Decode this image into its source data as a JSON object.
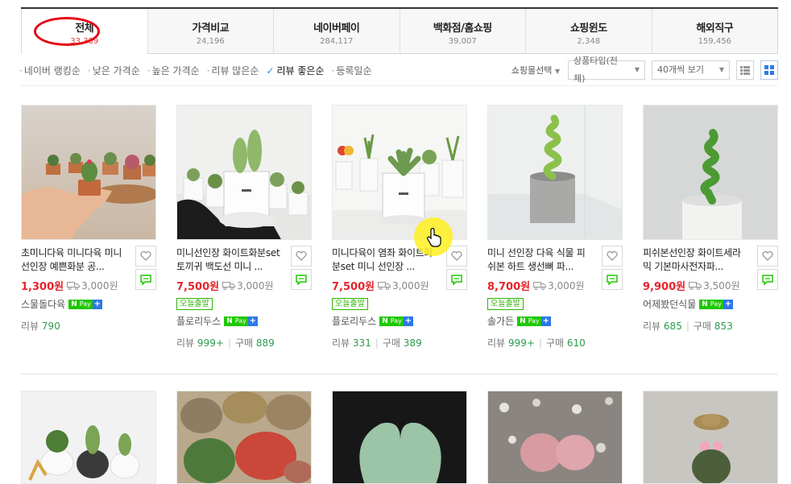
{
  "tabs": [
    {
      "name": "전체",
      "count": "33,389",
      "active": true
    },
    {
      "name": "가격비교",
      "count": "24,196"
    },
    {
      "name": "네이버페이",
      "count": "284,117"
    },
    {
      "name": "백화점/홈쇼핑",
      "count": "39,007"
    },
    {
      "name": "쇼핑윈도",
      "count": "2,348"
    },
    {
      "name": "해외직구",
      "count": "159,456"
    }
  ],
  "sort": {
    "options": [
      "네이버 랭킹순",
      "낮은 가격순",
      "높은 가격순",
      "리뷰 많은순",
      "리뷰 좋은순",
      "등록일순"
    ],
    "active": "리뷰 좋은순"
  },
  "filters": {
    "mall_label": "쇼핑몰선택",
    "type_select": "상품타입(전체)",
    "count_select": "40개씩 보기"
  },
  "products": [
    {
      "title": "초미니다육 미니다육 미니선인장 예쁜화분 공...",
      "price": "1,300원",
      "shipping": "3,000원",
      "seller": "스물돌다육",
      "today": "",
      "review_label": "리뷰",
      "review_count": "790",
      "buy_label": "",
      "buy_count": ""
    },
    {
      "title": "미니선인장 화이트화분set 토끼귀 백도선 미니 ...",
      "price": "7,500원",
      "shipping": "3,000원",
      "seller": "플로리두스",
      "today": "오늘출발",
      "review_label": "리뷰",
      "review_count": "999+",
      "buy_label": "구매",
      "buy_count": "889"
    },
    {
      "title": "미니다육이 염좌 화이트화분set 미니 선인장 ...",
      "price": "7,500원",
      "shipping": "3,000원",
      "seller": "플로리두스",
      "today": "오늘출발",
      "review_label": "리뷰",
      "review_count": "331",
      "buy_label": "구매",
      "buy_count": "389"
    },
    {
      "title": "미니 선인장 다육 식물 피쉬본 하트 생선뼈 파...",
      "price": "8,700원",
      "shipping": "3,000원",
      "seller": "솔가든",
      "today": "오늘출발",
      "review_label": "리뷰",
      "review_count": "999+",
      "buy_label": "구매",
      "buy_count": "610"
    },
    {
      "title": "피쉬본선인장 화이트세라믹 기본마사전자파...",
      "price": "9,900원",
      "shipping": "3,500원",
      "seller": "어제봤던식물",
      "today": "",
      "review_label": "리뷰",
      "review_count": "685",
      "buy_label": "구매",
      "buy_count": "853"
    }
  ],
  "npay": {
    "n": "N",
    "pay": "Pay",
    "plus": "+"
  },
  "colors": {
    "price": "#e5242b",
    "npay": "#1ec800",
    "accent": "#2e8be8",
    "circle": "#e60012",
    "review_num": "#2d9b4c"
  }
}
